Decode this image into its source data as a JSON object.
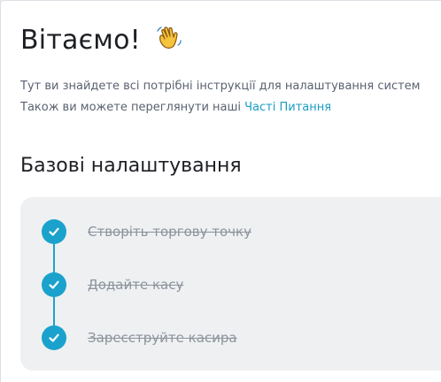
{
  "header": {
    "title": "Вітаємо!",
    "title_emoji_icon": "waving-hand-icon"
  },
  "intro": {
    "line1": "Тут ви знайдете всі потрібні інструкції для налаштування систем",
    "line2_prefix": "Також ви можете переглянути наші",
    "faq_link": "Часті Питання"
  },
  "basic_setup": {
    "title": "Базові налаштування",
    "steps": [
      {
        "label": "Створіть торгову точку",
        "done": true,
        "icon": "check-icon"
      },
      {
        "label": "Додайте касу",
        "done": true,
        "icon": "check-icon"
      },
      {
        "label": "Зареєструйте касира",
        "done": true,
        "icon": "check-icon"
      }
    ]
  },
  "colors": {
    "accent": "#1aa2cc",
    "link": "#1a9cc4",
    "completed_text": "#8c939c",
    "panel_bg": "#eef0f2"
  }
}
